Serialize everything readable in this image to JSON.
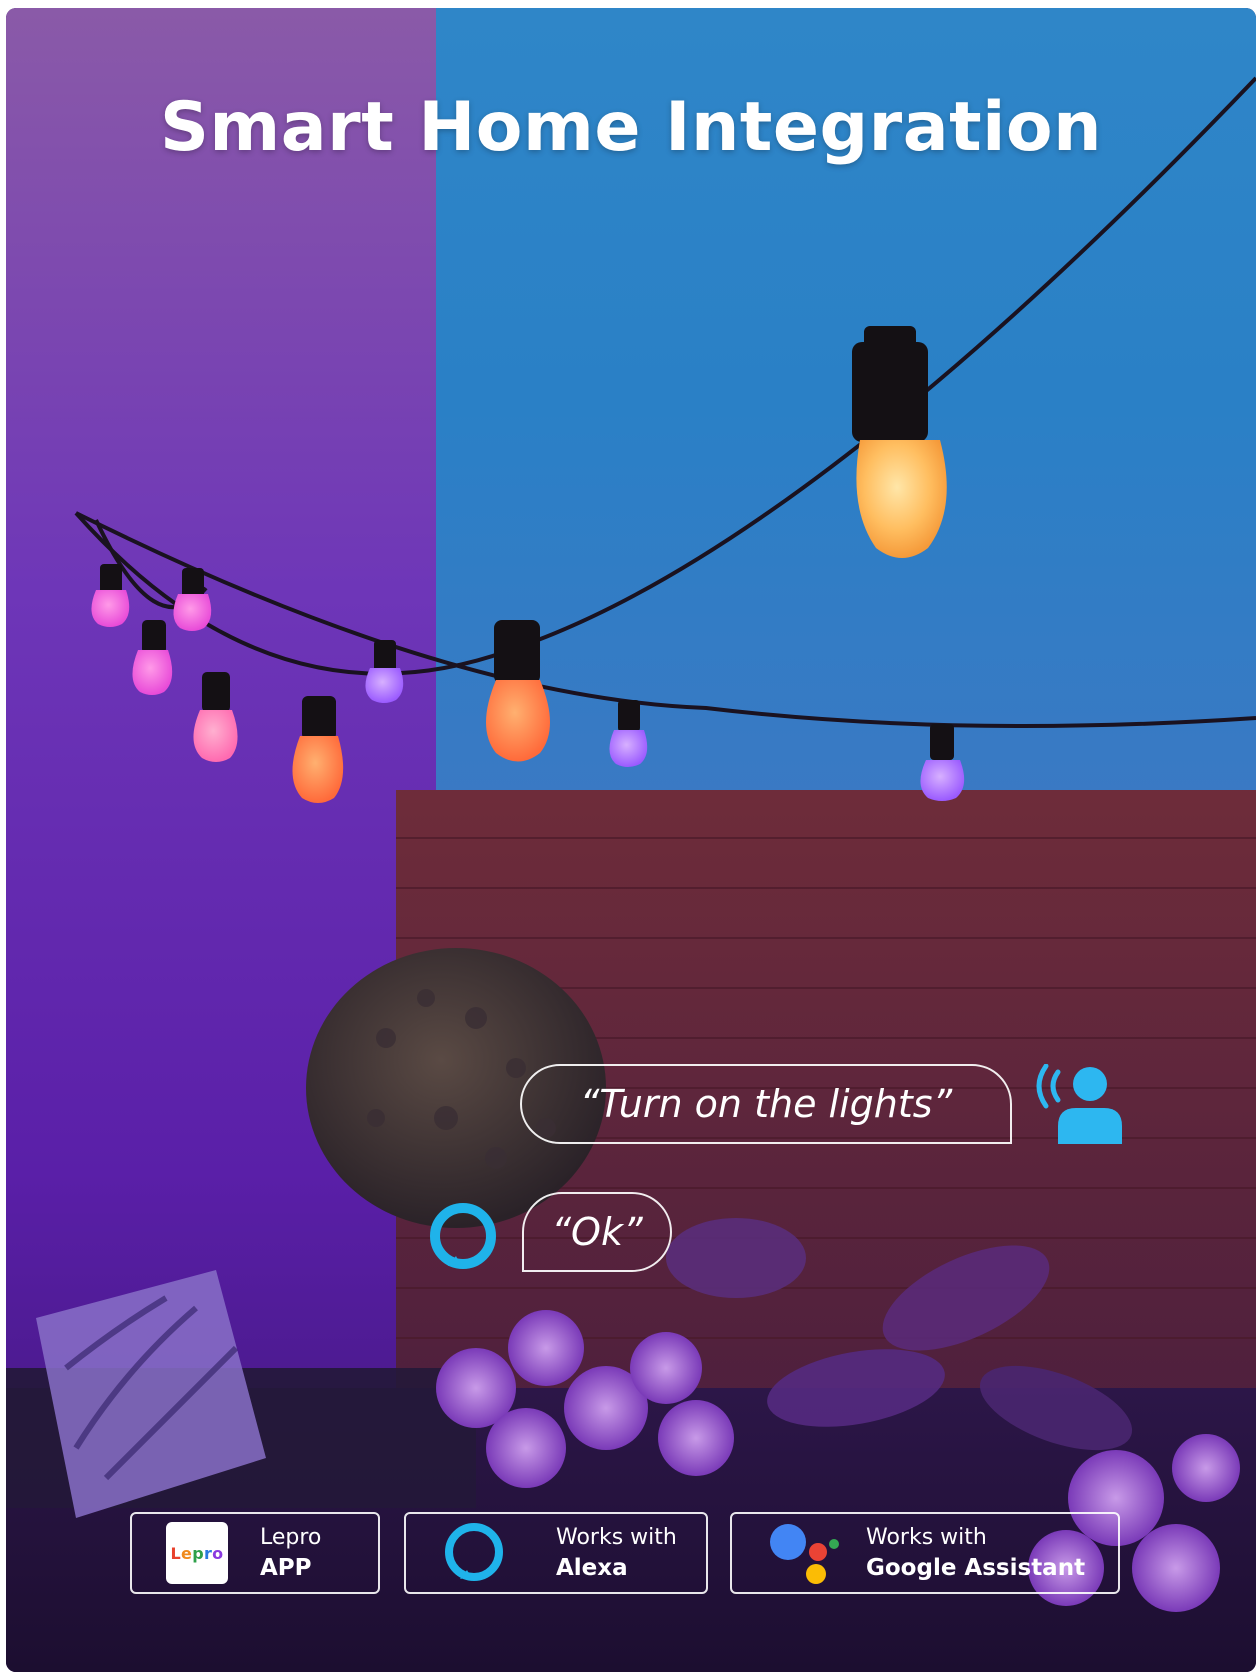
{
  "title": "Smart Home Integration",
  "dialog": {
    "user_says": "“Turn on the lights”",
    "assistant_replies": "“Ok”"
  },
  "badges": [
    {
      "logo_text": "Lepro",
      "line1": "Lepro",
      "line2": "APP"
    },
    {
      "line1": "Works with",
      "line2": "Alexa"
    },
    {
      "line1": "Works with",
      "line2": "Google Assistant"
    }
  ],
  "colors": {
    "alexa_blue": "#1fb3ea",
    "person_icon": "#2db7f0",
    "left_wall": "#6b2eb6",
    "sky": "#2a8ccf",
    "fence": "#6a2838",
    "google_blue": "#4285f4",
    "google_red": "#ea4335",
    "google_yellow": "#fbbc05",
    "google_green": "#34a853"
  },
  "icons": [
    "person-speaking-icon",
    "alexa-icon",
    "lepro-logo",
    "google-assistant-icon"
  ]
}
